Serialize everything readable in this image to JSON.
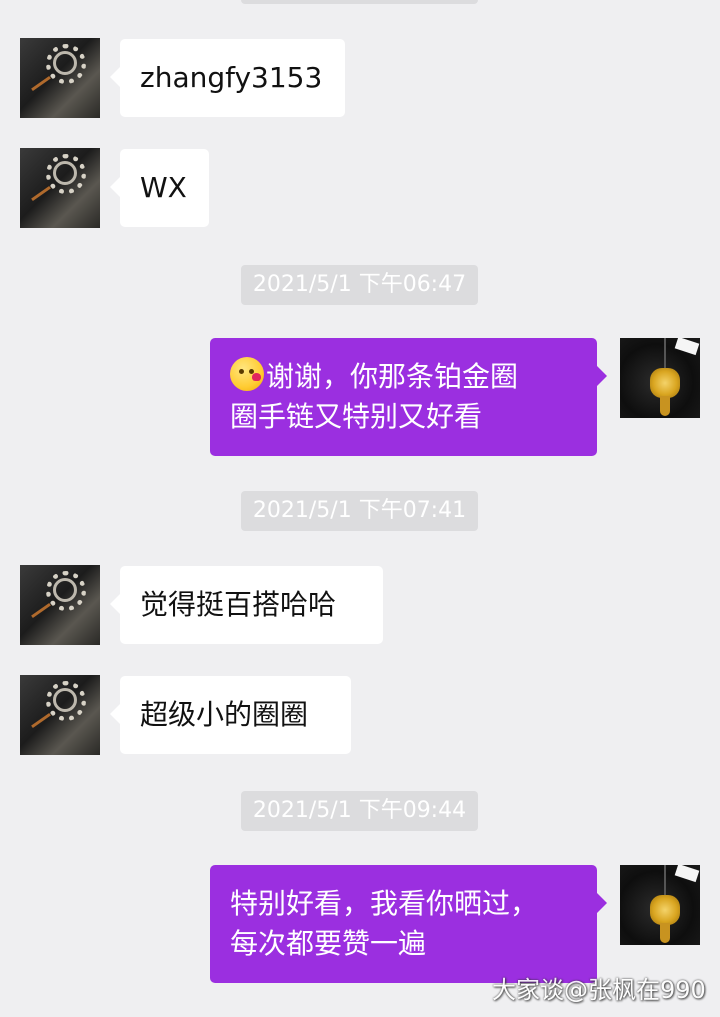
{
  "conversation": {
    "messages": [
      {
        "type": "received",
        "text": "zhangfy3153"
      },
      {
        "type": "received",
        "text": "WX"
      },
      {
        "type": "timestamp",
        "text": "2021/5/1 下午06:47"
      },
      {
        "type": "sent",
        "emoji": "kissing-heart-emoji",
        "text": "谢谢，你那条铂金圈\n圈手链又特别又好看"
      },
      {
        "type": "timestamp",
        "text": "2021/5/1 下午07:41"
      },
      {
        "type": "received",
        "text": "觉得挺百搭哈哈"
      },
      {
        "type": "received",
        "text": "超级小的圈圈"
      },
      {
        "type": "timestamp",
        "text": "2021/5/1 下午09:44"
      },
      {
        "type": "sent",
        "text": "特别好看，我看你晒过，\n每次都要赞一遍"
      }
    ]
  },
  "watermark": {
    "text": "大家谈@张枫在990"
  },
  "colors": {
    "background": "#efeff1",
    "sent_bubble": "#9b2fe0",
    "received_bubble": "#ffffff",
    "timestamp_bg": "#dcdcde"
  }
}
